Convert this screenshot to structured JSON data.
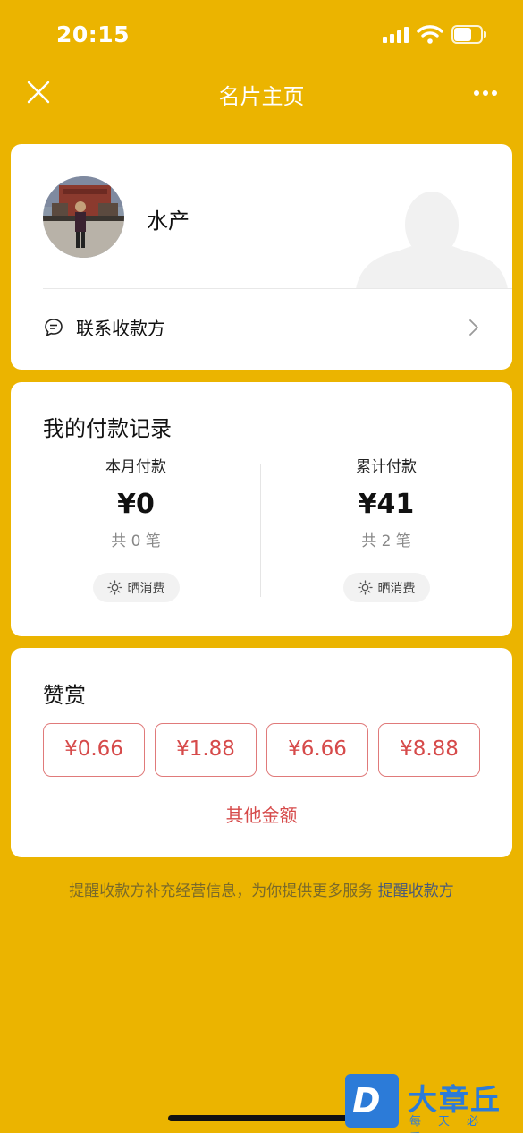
{
  "status_bar": {
    "time": "20:15"
  },
  "nav": {
    "title": "名片主页"
  },
  "profile": {
    "name": "水产",
    "contact_label": "联系收款方"
  },
  "payment_records": {
    "title": "我的付款记录",
    "this_month": {
      "label": "本月付款",
      "amount": "¥0",
      "count": "共 0 笔",
      "share_label": "晒消费"
    },
    "total": {
      "label": "累计付款",
      "amount": "¥41",
      "count": "共 2 笔",
      "share_label": "晒消费"
    }
  },
  "tip": {
    "title": "赞赏",
    "amounts": [
      "¥0.66",
      "¥1.88",
      "¥6.66",
      "¥8.88"
    ],
    "other_label": "其他金额"
  },
  "footer": {
    "text": "提醒收款方补充经营信息，为你提供更多服务 ",
    "link": "提醒收款方"
  },
  "watermark": {
    "letter": "D",
    "name": "大章丘",
    "sub": "每天必看"
  },
  "colors": {
    "background": "#EBB400",
    "accent_red": "#D64A4A",
    "watermark_blue": "#2C7BD8"
  }
}
